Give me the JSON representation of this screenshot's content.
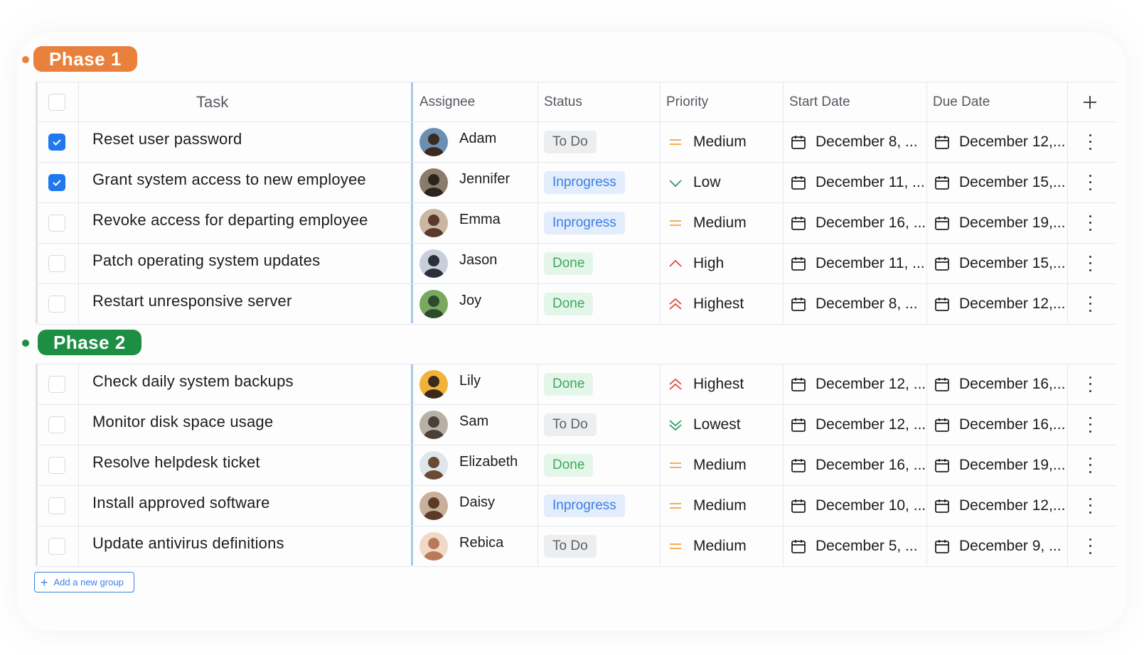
{
  "colors": {
    "phase1": "#e9803b",
    "phase2": "#1e8e44",
    "accent": "#1f78f0",
    "todo_bg": "#eceef0",
    "inprogress_bg": "#e3edfc",
    "done_bg": "#e4f6e9"
  },
  "columns": {
    "task": "Task",
    "assignee": "Assignee",
    "status": "Status",
    "priority": "Priority",
    "start_date": "Start Date",
    "due_date": "Due Date",
    "add_column_icon": "plus-icon"
  },
  "groups": [
    {
      "name": "Phase 1",
      "rows": [
        {
          "checked": true,
          "task": "Reset user password",
          "assignee": "Adam",
          "status": "To Do",
          "status_type": "todo",
          "priority": "Medium",
          "priority_icon": "medium-icon",
          "start": "December 8, ...",
          "due": "December 12,..."
        },
        {
          "checked": true,
          "task": "Grant system access to new employee",
          "assignee": "Jennifer",
          "status": "Inprogress",
          "status_type": "inprogress",
          "priority": "Low",
          "priority_icon": "low-icon",
          "start": "December 11, ...",
          "due": "December 15,..."
        },
        {
          "checked": false,
          "task": "Revoke access for departing employee",
          "assignee": "Emma",
          "status": "Inprogress",
          "status_type": "inprogress",
          "priority": "Medium",
          "priority_icon": "medium-icon",
          "start": "December 16, ...",
          "due": "December 19,..."
        },
        {
          "checked": false,
          "task": "Patch operating system updates",
          "assignee": "Jason",
          "status": "Done",
          "status_type": "done",
          "priority": "High",
          "priority_icon": "high-icon",
          "start": "December 11, ...",
          "due": "December 15,..."
        },
        {
          "checked": false,
          "task": "Restart unresponsive server",
          "assignee": "Joy",
          "status": "Done",
          "status_type": "done",
          "priority": "Highest",
          "priority_icon": "highest-icon",
          "start": "December 8, ...",
          "due": "December 12,..."
        }
      ]
    },
    {
      "name": "Phase 2",
      "rows": [
        {
          "checked": false,
          "task": "Check daily system backups",
          "assignee": "Lily",
          "status": "Done",
          "status_type": "done",
          "priority": "Highest",
          "priority_icon": "highest-icon",
          "start": "December 12, ...",
          "due": "December 16,..."
        },
        {
          "checked": false,
          "task": "Monitor disk space usage",
          "assignee": "Sam",
          "status": "To Do",
          "status_type": "todo",
          "priority": "Lowest",
          "priority_icon": "lowest-icon",
          "start": "December 12, ...",
          "due": "December 16,..."
        },
        {
          "checked": false,
          "task": "Resolve helpdesk ticket",
          "assignee": "Elizabeth",
          "status": "Done",
          "status_type": "done",
          "priority": "Medium",
          "priority_icon": "medium-icon",
          "start": "December 16, ...",
          "due": "December 19,..."
        },
        {
          "checked": false,
          "task": "Install approved software",
          "assignee": "Daisy",
          "status": "Inprogress",
          "status_type": "inprogress",
          "priority": "Medium",
          "priority_icon": "medium-icon",
          "start": "December 10, ...",
          "due": "December 12,..."
        },
        {
          "checked": false,
          "task": "Update antivirus definitions",
          "assignee": "Rebica",
          "status": "To Do",
          "status_type": "todo",
          "priority": "Medium",
          "priority_icon": "medium-icon",
          "start": "December 5, ...",
          "due": "December 9, ..."
        }
      ]
    }
  ],
  "add_group": {
    "label": "Add a new group",
    "icon": "plus-icon"
  }
}
